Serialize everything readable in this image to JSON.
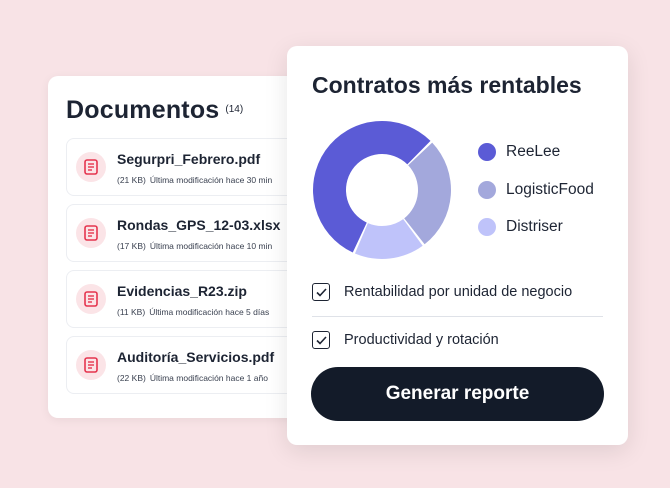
{
  "documents": {
    "title": "Documentos",
    "count": "(14)",
    "items": [
      {
        "name": "Segurpri_Febrero.pdf",
        "size": "(21 KB)",
        "modified": "Última modificación hace 30 min"
      },
      {
        "name": "Rondas_GPS_12-03.xlsx",
        "size": "(17 KB)",
        "modified": "Última modificación hace 10 min"
      },
      {
        "name": "Evidencias_R23.zip",
        "size": "(11 KB)",
        "modified": "Última modificación hace 5 días"
      },
      {
        "name": "Auditoría_Servicios.pdf",
        "size": "(22 KB)",
        "modified": "Última modificación hace 1 año"
      }
    ],
    "icon": "document-icon",
    "icon_color": "#e5354f"
  },
  "report": {
    "title": "Contratos más rentables",
    "legend": [
      {
        "label": "ReeLee",
        "color": "#5b5bd6"
      },
      {
        "label": "LogisticFood",
        "color": "#a3a8dc"
      },
      {
        "label": "Distriser",
        "color": "#bfc3fa"
      }
    ],
    "options": [
      {
        "label": "Rentabilidad por unidad de negocio",
        "checked": true
      },
      {
        "label": "Productividad y rotación",
        "checked": true
      }
    ],
    "button_label": "Generar reporte"
  },
  "chart_data": {
    "type": "pie",
    "categories": [
      "ReeLee",
      "LogisticFood",
      "Distriser"
    ],
    "values": [
      56,
      27,
      17
    ],
    "colors": [
      "#5b5bd6",
      "#a3a8dc",
      "#bfc3fa"
    ],
    "donut": true
  },
  "colors": {
    "background": "#f8e3e6",
    "button": "#131b29",
    "text": "#1d2433"
  }
}
